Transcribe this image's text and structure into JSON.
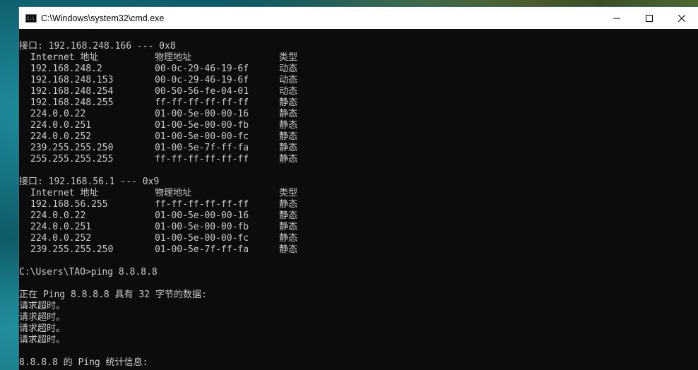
{
  "window": {
    "title": "C:\\Windows\\system32\\cmd.exe",
    "icon": "cmd-icon"
  },
  "console": {
    "interfaces": [
      {
        "header": "接口: 192.168.248.166 --- 0x8",
        "columns": [
          "Internet 地址",
          "物理地址",
          "类型"
        ],
        "rows": [
          [
            "192.168.248.2",
            "00-0c-29-46-19-6f",
            "动态"
          ],
          [
            "192.168.248.153",
            "00-0c-29-46-19-6f",
            "动态"
          ],
          [
            "192.168.248.254",
            "00-50-56-fe-04-01",
            "动态"
          ],
          [
            "192.168.248.255",
            "ff-ff-ff-ff-ff-ff",
            "静态"
          ],
          [
            "224.0.0.22",
            "01-00-5e-00-00-16",
            "静态"
          ],
          [
            "224.0.0.251",
            "01-00-5e-00-00-fb",
            "静态"
          ],
          [
            "224.0.0.252",
            "01-00-5e-00-00-fc",
            "静态"
          ],
          [
            "239.255.255.250",
            "01-00-5e-7f-ff-fa",
            "静态"
          ],
          [
            "255.255.255.255",
            "ff-ff-ff-ff-ff-ff",
            "静态"
          ]
        ]
      },
      {
        "header": "接口: 192.168.56.1 --- 0x9",
        "columns": [
          "Internet 地址",
          "物理地址",
          "类型"
        ],
        "rows": [
          [
            "192.168.56.255",
            "ff-ff-ff-ff-ff-ff",
            "静态"
          ],
          [
            "224.0.0.22",
            "01-00-5e-00-00-16",
            "静态"
          ],
          [
            "224.0.0.251",
            "01-00-5e-00-00-fb",
            "静态"
          ],
          [
            "224.0.0.252",
            "01-00-5e-00-00-fc",
            "静态"
          ],
          [
            "239.255.255.250",
            "01-00-5e-7f-ff-fa",
            "静态"
          ]
        ]
      }
    ],
    "prompt_line": "C:\\Users\\TAO>ping 8.8.8.8",
    "ping_header": "正在 Ping 8.8.8.8 具有 32 字节的数据:",
    "ping_results": [
      "请求超时。",
      "请求超时。",
      "请求超时。",
      "请求超时。"
    ],
    "stats_header": "8.8.8.8 的 Ping 统计信息:"
  },
  "colors": {
    "console_bg": "#0c0c0c",
    "console_text": "#cccccc",
    "titlebar_bg": "#ffffff"
  }
}
